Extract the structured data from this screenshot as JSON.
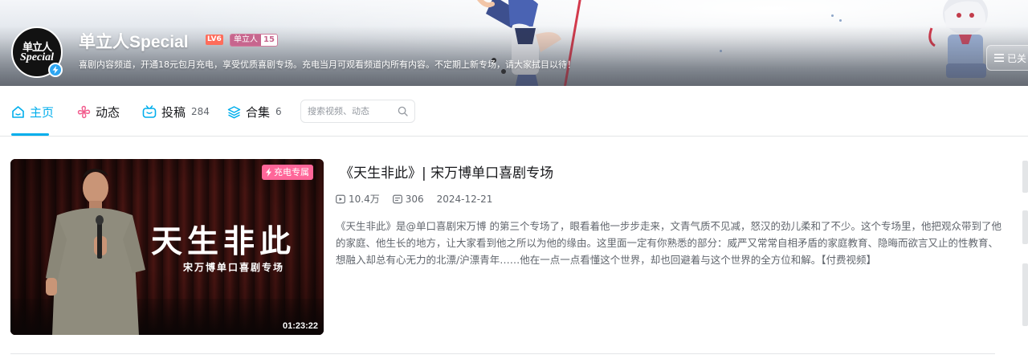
{
  "header": {
    "up_name": "单立人Special",
    "level_badge": "LV6",
    "fan_badge": {
      "name": "单立人",
      "level": "15"
    },
    "sign": "喜剧内容频道，开通18元包月充电，享受优质喜剧专场。充电当月可观看频道内所有内容。不定期上新专场，请大家拭目以待！",
    "avatar_text": {
      "line1": "单立人",
      "line2": "Special"
    },
    "follow_label": "已关",
    "follow_icon": "menu-lines-icon"
  },
  "nav": {
    "tabs": [
      {
        "label": "主页",
        "icon": "home-icon",
        "count": ""
      },
      {
        "label": "动态",
        "icon": "pinwheel-icon",
        "count": ""
      },
      {
        "label": "投稿",
        "icon": "tv-icon",
        "count": "284"
      },
      {
        "label": "合集",
        "icon": "stack-icon",
        "count": "6"
      }
    ],
    "search_placeholder": "搜索视频、动态",
    "accent_color": "#00aeec"
  },
  "video": {
    "title": "《天生非此》| 宋万博单口喜剧专场",
    "views": "10.4万",
    "comments": "306",
    "date": "2024-12-21",
    "description": "《天生非此》是@单口喜剧宋万博 的第三个专场了，眼看着他一步步走来，文青气质不见减，怒汉的劲儿柔和了不少。这个专场里，他把观众带到了他的家庭、他生长的地方，让大家看到他之所以为他的缘由。这里面一定有你熟悉的部分：威严又常常自相矛盾的家庭教育、隐晦而欲言又止的性教育、想融入却总有心无力的北漂/沪漂青年……他在一点一点看懂这个世界，却也回避着与这个世界的全方位和解。【付费视频】",
    "thumbnail": {
      "title": "天生非此",
      "subtitle": "宋万博单口喜剧专场",
      "badge": "充电专属",
      "duration": "01:23:22"
    }
  }
}
